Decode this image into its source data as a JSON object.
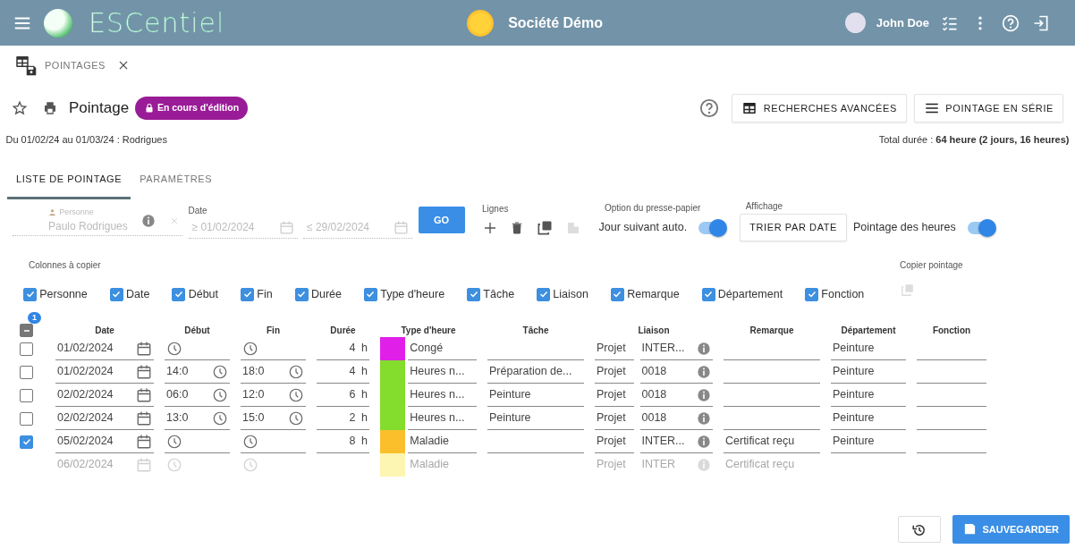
{
  "header": {
    "logo_text": "ESCentiel",
    "company": "Société Démo",
    "user": "John Doe"
  },
  "doc_tab": {
    "label": "POINTAGES"
  },
  "page": {
    "title": "Pointage",
    "status_badge": "En cours d'édition",
    "summary": "Du 01/02/24 au 01/03/24 : Rodrigues",
    "total": "Total durée : **64 heure (2 jours, 16 heures)**"
  },
  "actions": [
    {
      "kind": "table",
      "label": "RECHERCHES AVANCÉES"
    },
    {
      "kind": "list",
      "label": "POINTAGE EN SÉRIE"
    }
  ],
  "tabs": [
    {
      "label": "LISTE DE POINTAGE",
      "selected": true
    },
    {
      "label": "PARAMÈTRES",
      "selected": false
    }
  ],
  "filters": {
    "person_label": "Personne",
    "person_value": "Paulo Rodrigues",
    "date_label": "Date",
    "date_from": "≥ 01/02/2024",
    "date_to": "≤ 29/02/2024",
    "go": "GO"
  },
  "lines": {
    "label": "Lignes"
  },
  "clipboard": {
    "label": "Option du presse-papier",
    "toggle_label": "Jour suivant auto.",
    "on": true
  },
  "display": {
    "label": "Affichage",
    "sort_button": "TRIER PAR DATE",
    "toggle_label": "Pointage des heures",
    "on": true
  },
  "copy_columns": {
    "label": "Colonnes à copier",
    "items": [
      {
        "label": "Personne",
        "checked": true
      },
      {
        "label": "Date",
        "checked": true
      },
      {
        "label": "Début",
        "checked": true
      },
      {
        "label": "Fin",
        "checked": true
      },
      {
        "label": "Durée",
        "checked": true
      },
      {
        "label": "Type d'heure",
        "checked": true
      },
      {
        "label": "Tâche",
        "checked": true
      },
      {
        "label": "Liaison",
        "checked": true
      },
      {
        "label": "Remarque",
        "checked": true
      },
      {
        "label": "Département",
        "checked": true
      },
      {
        "label": "Fonction",
        "checked": true
      }
    ]
  },
  "copy_pointage": {
    "label": "Copier pointage"
  },
  "table": {
    "select_all_indeterminate": true,
    "selected_count": "1",
    "columns": [
      "Date",
      "Début",
      "Fin",
      "Durée",
      "Type d'heure",
      "Tâche",
      "Liaison",
      "Remarque",
      "Département",
      "Fonction"
    ],
    "rows": [
      {
        "kind": "entry",
        "checked": false,
        "date": "01/02/2024",
        "duration": "4",
        "unit": "h",
        "type": "Congé",
        "color": "#e020e8",
        "liaison_type": "Projet",
        "liaison": "INTER...",
        "department": "Peinture"
      },
      {
        "kind": "entry",
        "checked": false,
        "date": "01/02/2024",
        "start": "14:0",
        "end": "18:0",
        "duration": "4",
        "unit": "h",
        "type": "Heures n...",
        "color": "#84dc2c",
        "task": "Préparation de...",
        "liaison_type": "Projet",
        "liaison": "0018",
        "department": "Peinture"
      },
      {
        "kind": "entry",
        "checked": false,
        "date": "02/02/2024",
        "start": "06:0",
        "end": "12:0",
        "duration": "6",
        "unit": "h",
        "type": "Heures n...",
        "color": "#84dc2c",
        "task": "Peinture",
        "liaison_type": "Projet",
        "liaison": "0018",
        "department": "Peinture"
      },
      {
        "kind": "entry",
        "checked": false,
        "date": "02/02/2024",
        "start": "13:0",
        "end": "15:0",
        "duration": "2",
        "unit": "h",
        "type": "Heures n...",
        "color": "#84dc2c",
        "task": "Peinture",
        "liaison_type": "Projet",
        "liaison": "0018",
        "department": "Peinture"
      },
      {
        "kind": "entry",
        "checked": true,
        "date": "05/02/2024",
        "duration": "8",
        "unit": "h",
        "type": "Maladie",
        "color": "#fbbf2c",
        "liaison_type": "Projet",
        "liaison": "INTER...",
        "remark": "Certificat reçu",
        "department": "Peinture"
      },
      {
        "kind": "ghost",
        "date": "06/02/2024",
        "type": "Maladie",
        "color": "#fdf5b2",
        "liaison_type": "Projet",
        "liaison": "INTER",
        "remark": "Certificat reçu"
      }
    ]
  },
  "footer": {
    "save": "SAUVEGARDER"
  }
}
